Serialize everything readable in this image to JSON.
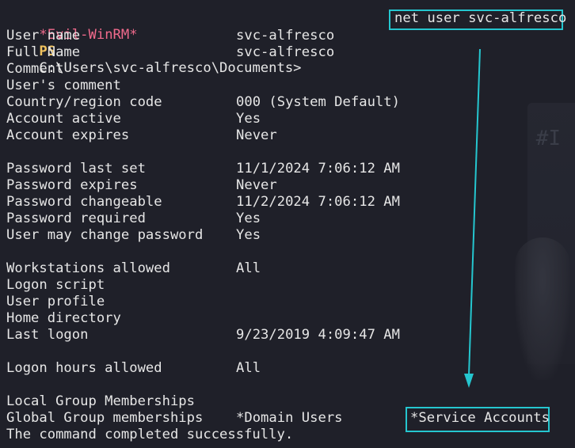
{
  "prompt": {
    "shell": "*Evil-WinRM*",
    "ps": "PS",
    "path": "C:\\Users\\svc-alfresco\\Documents>",
    "command": "net user svc-alfresco"
  },
  "rows": [
    {
      "label": "User name",
      "value": "svc-alfresco"
    },
    {
      "label": "Full Name",
      "value": "svc-alfresco"
    },
    {
      "label": "Comment",
      "value": ""
    },
    {
      "label": "User's comment",
      "value": ""
    },
    {
      "label": "Country/region code",
      "value": "000 (System Default)"
    },
    {
      "label": "Account active",
      "value": "Yes"
    },
    {
      "label": "Account expires",
      "value": "Never"
    },
    {
      "label": "",
      "value": ""
    },
    {
      "label": "Password last set",
      "value": "11/1/2024 7:06:12 AM"
    },
    {
      "label": "Password expires",
      "value": "Never"
    },
    {
      "label": "Password changeable",
      "value": "11/2/2024 7:06:12 AM"
    },
    {
      "label": "Password required",
      "value": "Yes"
    },
    {
      "label": "User may change password",
      "value": "Yes"
    },
    {
      "label": "",
      "value": ""
    },
    {
      "label": "Workstations allowed",
      "value": "All"
    },
    {
      "label": "Logon script",
      "value": ""
    },
    {
      "label": "User profile",
      "value": ""
    },
    {
      "label": "Home directory",
      "value": ""
    },
    {
      "label": "Last logon",
      "value": "9/23/2019 4:09:47 AM"
    },
    {
      "label": "",
      "value": ""
    },
    {
      "label": "Logon hours allowed",
      "value": "All"
    },
    {
      "label": "",
      "value": ""
    },
    {
      "label": "Local Group Memberships",
      "value": ""
    },
    {
      "label": "Global Group memberships",
      "value": "*Domain Users"
    }
  ],
  "highlighted_group": "*Service Accounts",
  "footer": "The command completed successfully.",
  "colors": {
    "background": "#1f2029",
    "highlight": "#25c6cf",
    "shell": "#f06a8c",
    "ps": "#f0c25e"
  }
}
